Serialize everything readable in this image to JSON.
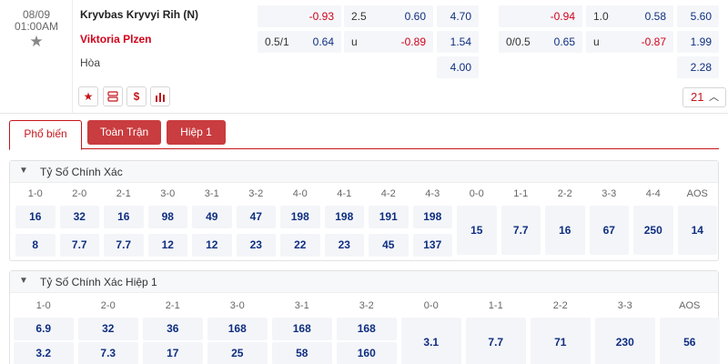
{
  "match": {
    "date": "08/09",
    "time": "01:00AM",
    "home": "Kryvbas Kryvyi Rih (N)",
    "away": "Viktoria Plzen",
    "draw": "Hòa",
    "more_count": "21"
  },
  "odds_ft": {
    "hdp_row1": "-0.93",
    "hdp_row2_line": "0.5/1",
    "hdp_row2": "0.64",
    "ou_row1_line": "2.5",
    "ou_row1": "0.60",
    "ou_row2_line": "u",
    "ou_row2": "-0.89",
    "x12_home": "4.70",
    "x12_away": "1.54",
    "x12_draw": "4.00"
  },
  "odds_h1": {
    "hdp_row1": "-0.94",
    "hdp_row2_line": "0/0.5",
    "hdp_row2": "0.65",
    "ou_row1_line": "1.0",
    "ou_row1": "0.58",
    "ou_row2_line": "u",
    "ou_row2": "-0.87",
    "x12_home": "5.60",
    "x12_away": "1.99",
    "x12_draw": "2.28"
  },
  "tabs": [
    "Phổ biến",
    "Toàn Trận",
    "Hiệp 1"
  ],
  "correct_score": {
    "title": "Tỷ Số Chính Xác",
    "headers": [
      "1-0",
      "2-0",
      "2-1",
      "3-0",
      "3-1",
      "3-2",
      "4-0",
      "4-1",
      "4-2",
      "4-3",
      "0-0",
      "1-1",
      "2-2",
      "3-3",
      "4-4",
      "AOS"
    ],
    "row_home": [
      "16",
      "32",
      "16",
      "98",
      "49",
      "47",
      "198",
      "198",
      "191",
      "198"
    ],
    "row_away": [
      "8",
      "7.7",
      "7.7",
      "12",
      "12",
      "23",
      "22",
      "23",
      "45",
      "137"
    ],
    "draws": [
      "15",
      "7.7",
      "16",
      "67",
      "250",
      "14"
    ]
  },
  "correct_score_h1": {
    "title": "Tỷ Số Chính Xác Hiệp 1",
    "headers": [
      "1-0",
      "2-0",
      "2-1",
      "3-0",
      "3-1",
      "3-2",
      "0-0",
      "1-1",
      "2-2",
      "3-3",
      "AOS"
    ],
    "row_home": [
      "6.9",
      "32",
      "36",
      "168",
      "168",
      "168"
    ],
    "row_away": [
      "3.2",
      "7.3",
      "17",
      "25",
      "58",
      "160"
    ],
    "draws": [
      "3.1",
      "7.7",
      "71",
      "230",
      "56"
    ]
  },
  "colors": {
    "accent": "#c4161c",
    "odds_blue": "#0e2f80",
    "negative_red": "#d0021b",
    "cell_bg": "#f4f5f9"
  },
  "icons": [
    "star-icon",
    "favorite-icon",
    "layers-icon",
    "dollar-icon",
    "chart-icon",
    "chevron-up-icon",
    "chevron-down-icon"
  ]
}
